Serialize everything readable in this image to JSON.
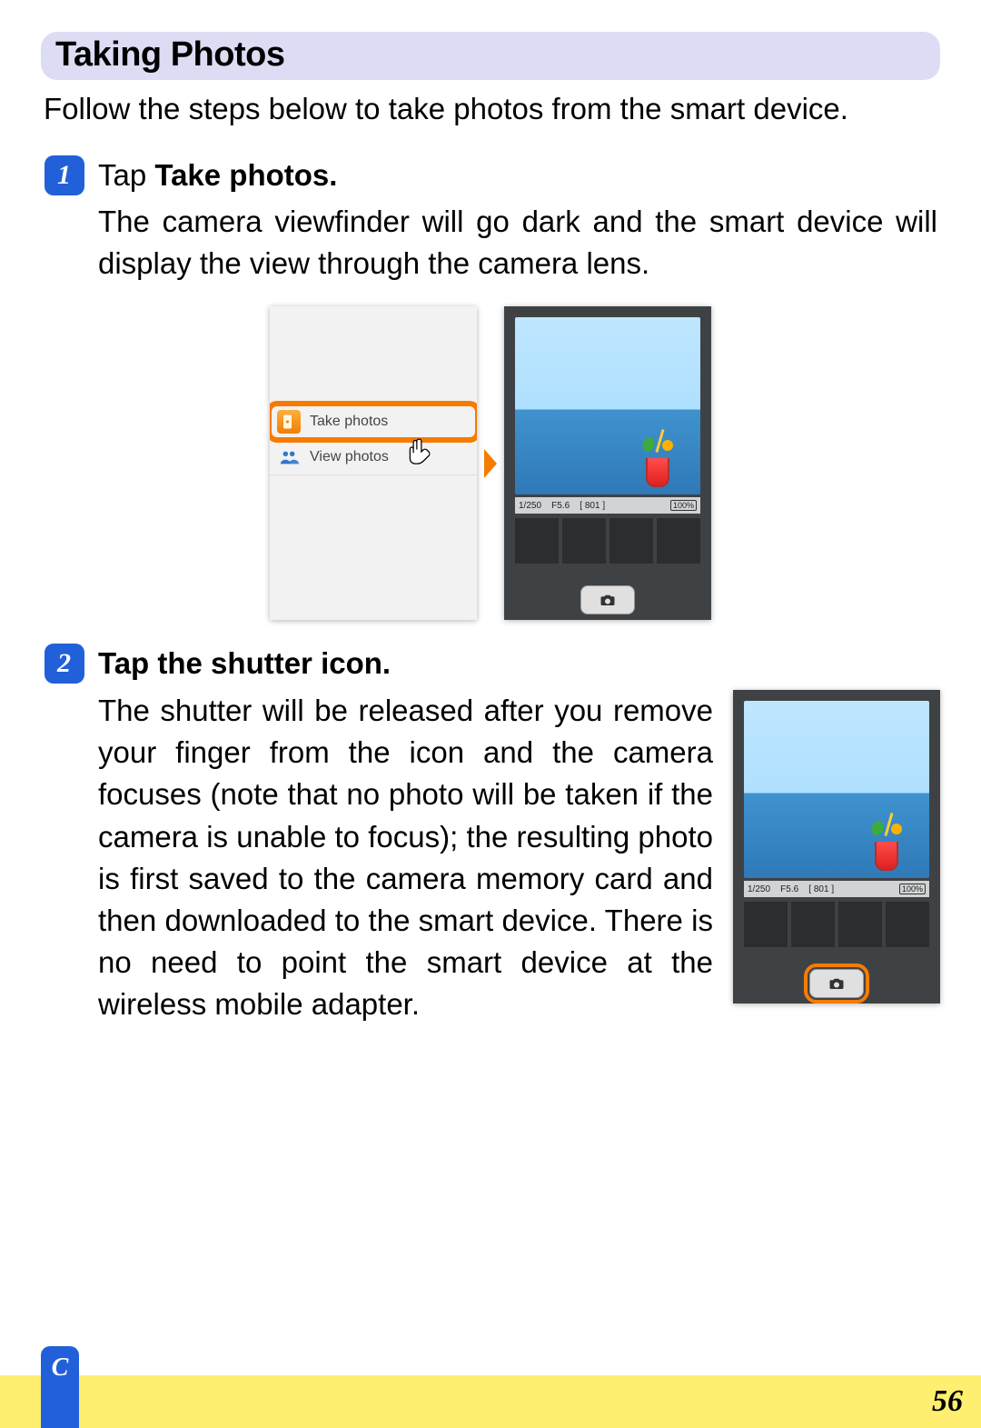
{
  "section_heading": "Taking Photos",
  "intro": "Follow the steps below to take photos from the smart device.",
  "steps": [
    {
      "num": "1",
      "head_prefix": "Tap ",
      "head_bold": "Take photos.",
      "body": "The camera viewfinder will go dark and the smart device will display the view through the camera lens."
    },
    {
      "num": "2",
      "head_bold": "Tap the shutter icon.",
      "body": "The shutter will be released after you remove your finger from the icon and the camera focuses (note that no photo will be taken if the camera is unable to focus); the resulting photo is first saved to the camera memory card and then downloaded to the smart device. There is no need to point the smart device at the wireless mobile adapter."
    }
  ],
  "app_menu": {
    "take_photos": "Take photos",
    "view_photos": "View photos"
  },
  "viewfinder": {
    "shutter_speed": "1/250",
    "f_number": "F5.6",
    "shots_remaining": "[ 801 ]",
    "battery": "100%"
  },
  "footer": {
    "section_letter": "C",
    "page_number": "56"
  }
}
